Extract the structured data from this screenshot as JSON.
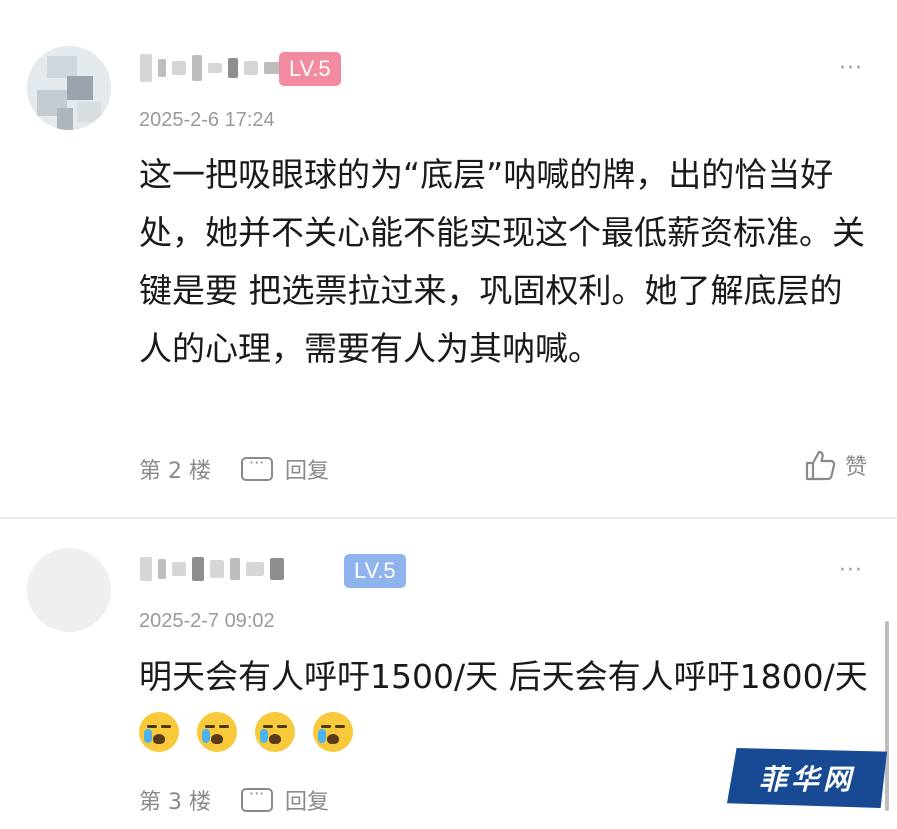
{
  "comments": [
    {
      "level": "LV.5",
      "time": "2025-2-6 17:24",
      "text": "这一把吸眼球的为“底层”呐喊的牌，出的恰当好处，她并不关心能不能实现这个最低薪资标准。关键是要 把选票拉过来，巩固权利。她了解底层的人的心理，需要有人为其呐喊。",
      "floor": "第 2 楼",
      "reply_label": "回复",
      "like_label": "赞",
      "more": "···"
    },
    {
      "level": "LV.5",
      "time": "2025-2-7 09:02",
      "text": "明天会有人呼吁1500/天 后天会有人呼吁1800/天",
      "emoji_count": 4,
      "floor": "第 3 楼",
      "reply_label": "回复",
      "more": "···"
    }
  ],
  "watermark": "菲华网",
  "colors": {
    "level_pink": "#f28aa0",
    "level_blue": "#8fb3ec",
    "watermark_bg": "#174a92",
    "muted_text": "#9a9a9a"
  },
  "icons": [
    "more-icon",
    "reply-icon",
    "thumb-up-icon",
    "crying-emoji-icon"
  ]
}
